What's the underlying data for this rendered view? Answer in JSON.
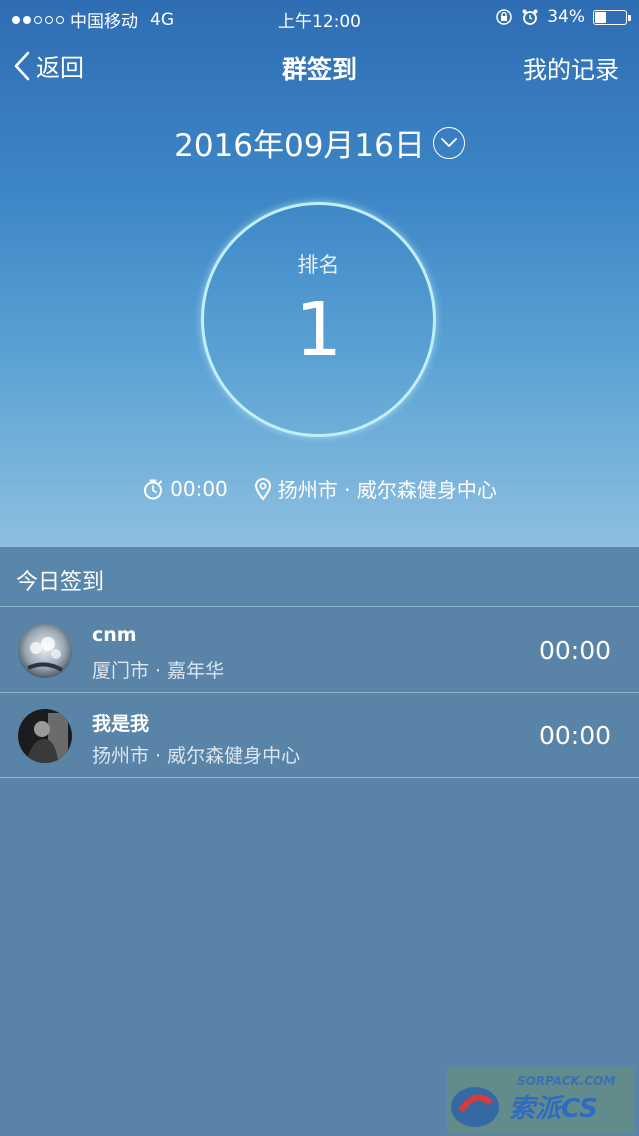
{
  "status_bar": {
    "carrier": "中国移动",
    "network": "4G",
    "time": "上午12:00",
    "battery_percent": "34%",
    "battery_level": 0.34
  },
  "nav": {
    "back_label": "返回",
    "title": "群签到",
    "right_label": "我的记录"
  },
  "date": "2016年09月16日",
  "rank": {
    "label": "排名",
    "value": "1"
  },
  "meta": {
    "time": "00:00",
    "location": "扬州市 · 威尔森健身中心"
  },
  "today": {
    "title": "今日签到",
    "items": [
      {
        "name": "cnm",
        "location": "厦门市 · 嘉年华",
        "time": "00:00"
      },
      {
        "name": "我是我",
        "location": "扬州市 · 威尔森健身中心",
        "time": "00:00"
      }
    ]
  },
  "watermark": {
    "site": "SORPACK.COM",
    "brand": "索派CS"
  },
  "colors": {
    "hero_top": "#2f6db3",
    "hero_bottom": "#8ebfe0",
    "list_bg": "#5a84a7",
    "ring": "#bfeff7"
  }
}
